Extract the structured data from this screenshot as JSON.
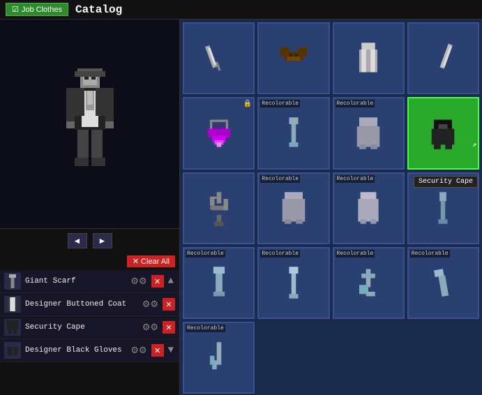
{
  "topBar": {
    "jobClothesLabel": "Job Clothes",
    "catalogTitle": "Catalog"
  },
  "equipped": {
    "clearAllLabel": "Clear All",
    "items": [
      {
        "id": "giant-scarf",
        "name": "Giant Scarf",
        "icon": "🧣",
        "hasScroll": true
      },
      {
        "id": "designer-buttoned-coat",
        "name": "Designer Buttoned Coat",
        "icon": "🧥",
        "hasScroll": false
      },
      {
        "id": "security-cape",
        "name": "Security Cape",
        "icon": "🦇",
        "hasScroll": false
      },
      {
        "id": "designer-black-gloves",
        "name": "Designer Black Gloves",
        "icon": "🧤",
        "hasScroll": true
      }
    ]
  },
  "catalog": {
    "tooltip": "Security Cape",
    "items": [
      {
        "id": "item-1",
        "label": "",
        "recolorable": false,
        "selected": false,
        "locked": false,
        "color": "#2a4070"
      },
      {
        "id": "item-2",
        "label": "",
        "recolorable": false,
        "selected": false,
        "locked": false,
        "color": "#2a4070"
      },
      {
        "id": "item-3",
        "label": "",
        "recolorable": false,
        "selected": false,
        "locked": false,
        "color": "#2a4070"
      },
      {
        "id": "item-4",
        "label": "",
        "recolorable": false,
        "selected": false,
        "locked": false,
        "color": "#2a4070"
      },
      {
        "id": "item-5",
        "label": "",
        "recolorable": false,
        "selected": false,
        "locked": true,
        "color": "#2a4070"
      },
      {
        "id": "item-6",
        "label": "Recolorable",
        "recolorable": true,
        "selected": false,
        "locked": false,
        "color": "#2a4070"
      },
      {
        "id": "item-7",
        "label": "Recolorable",
        "recolorable": true,
        "selected": false,
        "locked": false,
        "color": "#2a4070"
      },
      {
        "id": "item-8",
        "label": "",
        "recolorable": false,
        "selected": true,
        "locked": false,
        "color": "#2aaa2a"
      },
      {
        "id": "item-9",
        "label": "",
        "recolorable": false,
        "selected": false,
        "locked": false,
        "color": "#2a4070"
      },
      {
        "id": "item-10",
        "label": "Recolorable",
        "recolorable": true,
        "selected": false,
        "locked": false,
        "color": "#2a4070"
      },
      {
        "id": "item-11",
        "label": "Recolorable",
        "recolorable": true,
        "selected": false,
        "locked": false,
        "color": "#2a4070"
      },
      {
        "id": "item-12",
        "label": "",
        "recolorable": false,
        "selected": false,
        "locked": false,
        "color": "#2a4070"
      },
      {
        "id": "item-13",
        "label": "Recolorable",
        "recolorable": true,
        "selected": false,
        "locked": false,
        "color": "#2a4070"
      },
      {
        "id": "item-14",
        "label": "Recolorable",
        "recolorable": true,
        "selected": false,
        "locked": false,
        "color": "#2a4070"
      },
      {
        "id": "item-15",
        "label": "Recolorable",
        "recolorable": true,
        "selected": false,
        "locked": false,
        "color": "#2a4070"
      },
      {
        "id": "item-16",
        "label": "Recolorable",
        "recolorable": true,
        "selected": false,
        "locked": false,
        "color": "#2a4070"
      },
      {
        "id": "item-17",
        "label": "Recolorable",
        "recolorable": true,
        "selected": false,
        "locked": false,
        "color": "#2a4070"
      }
    ]
  },
  "nav": {
    "prevLabel": "◄",
    "nextLabel": "►"
  }
}
